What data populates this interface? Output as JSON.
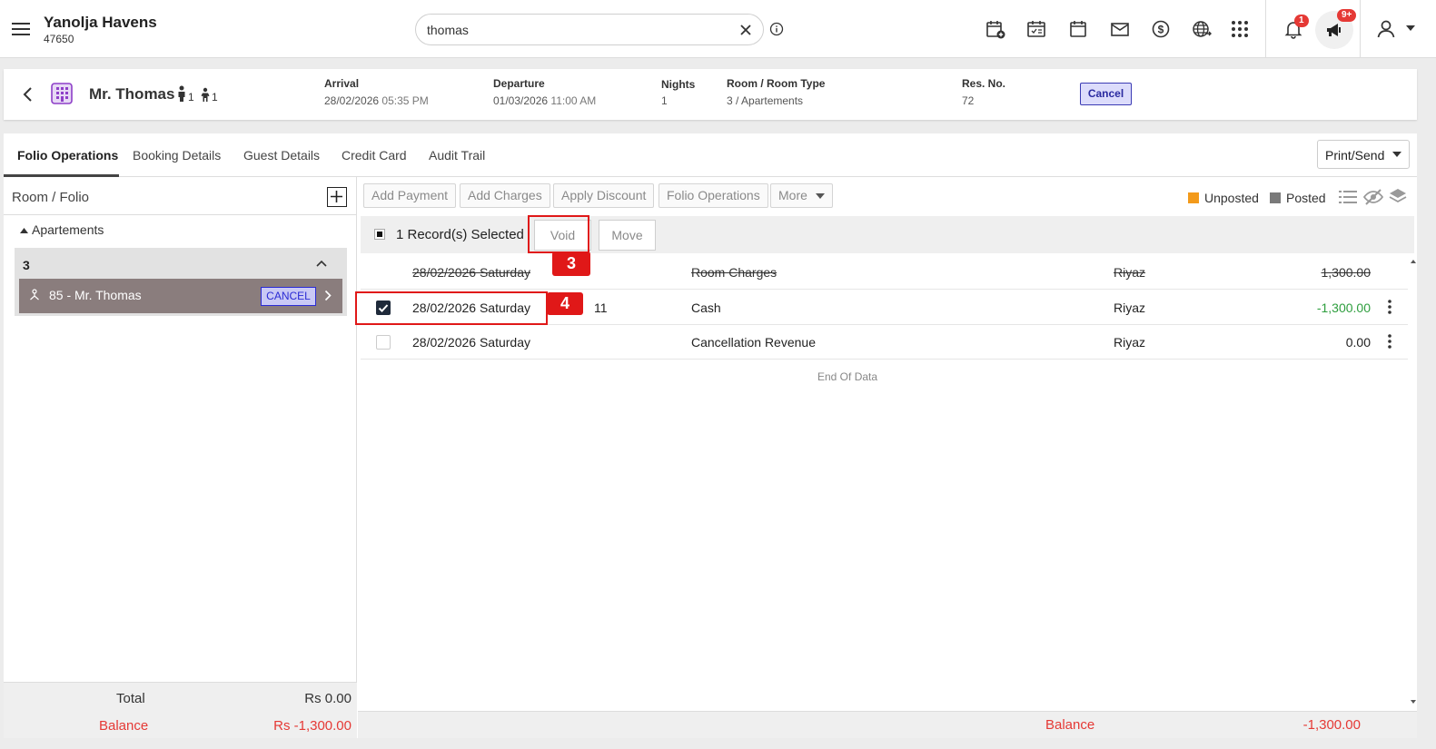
{
  "app": {
    "hotel_name": "Yanolja Havens",
    "hotel_id": "47650",
    "search": {
      "value": "thomas",
      "placeholder": ""
    },
    "notifications_badge": "1",
    "announcements_badge": "9+",
    "icons": [
      "menu-icon",
      "calendar-add-icon",
      "calendar-check-icon",
      "calendar-icon",
      "mail-icon",
      "dollar-icon",
      "globe-icon",
      "apps-grid-icon",
      "bell-icon",
      "megaphone-icon",
      "user-icon"
    ]
  },
  "reservation": {
    "guest_name": "Mr. Thomas",
    "adults": "1",
    "children": "1",
    "arrival_label": "Arrival",
    "arrival_date": "28/02/2026",
    "arrival_time": "05:35 PM",
    "departure_label": "Departure",
    "departure_date": "01/03/2026",
    "departure_time": "11:00 AM",
    "nights_label": "Nights",
    "nights": "1",
    "room_label": "Room / Room Type",
    "room": "3 / Apartements",
    "resno_label": "Res. No.",
    "resno": "72",
    "status": "Cancel"
  },
  "tabs": [
    "Folio Operations",
    "Booking Details",
    "Guest Details",
    "Credit Card",
    "Audit Trail"
  ],
  "print_send": "Print/Send",
  "left": {
    "title": "Room / Folio",
    "group": "Apartements",
    "room": "3",
    "folio": "85 - Mr. Thomas",
    "folio_status": "CANCEL",
    "total_label": "Total",
    "total_value": "Rs 0.00",
    "balance_label": "Balance",
    "balance_value": "Rs -1,300.00"
  },
  "toolbar": {
    "add_payment": "Add Payment",
    "add_charges": "Add Charges",
    "apply_discount": "Apply Discount",
    "folio_operations": "Folio Operations",
    "more": "More",
    "legend_unposted": "Unposted",
    "legend_posted": "Posted",
    "unposted_color": "#f39a1b",
    "posted_color": "#7a7a7a"
  },
  "selection": {
    "text": "1 Record(s) Selected",
    "void": "Void",
    "move": "Move",
    "step_void": "3",
    "step_row": "4"
  },
  "rows": [
    {
      "date": "28/02/2026 Saturday",
      "ref": "",
      "desc": "Room Charges",
      "user": "Riyaz",
      "amount": "1,300.00"
    },
    {
      "date": "28/02/2026 Saturday",
      "ref": "11",
      "desc": "Cash",
      "user": "Riyaz",
      "amount": "-1,300.00"
    },
    {
      "date": "28/02/2026 Saturday",
      "ref": "",
      "desc": "Cancellation Revenue",
      "user": "Riyaz",
      "amount": "0.00"
    }
  ],
  "end_of_data": "End Of Data",
  "footer": {
    "balance_label": "Balance",
    "balance_value": "-1,300.00"
  }
}
